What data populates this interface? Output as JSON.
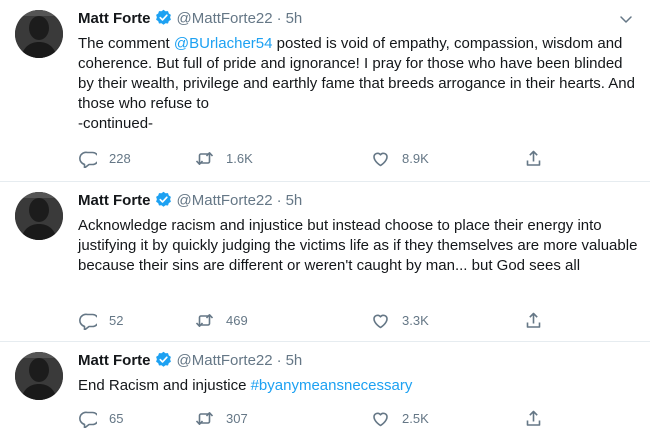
{
  "tweets": [
    {
      "name": "Matt Forte",
      "handle": "@MattForte22",
      "dot": "·",
      "time": "5h",
      "text_pre": "The comment ",
      "mention": "@BUrlacher54",
      "text_post": " posted is void of empathy, compassion, wisdom and coherence. But full of pride and ignorance! I pray for those who have been blinded by their wealth, privilege and earthly fame that breeds arrogance in their hearts. And those who refuse to",
      "text_line2": "-continued-",
      "replies": "228",
      "retweets": "1.6K",
      "likes": "8.9K"
    },
    {
      "name": "Matt Forte",
      "handle": "@MattForte22",
      "dot": "·",
      "time": "5h",
      "text": "Acknowledge racism and injustice but instead choose to place their energy into justifying it by quickly judging the victims life as if they themselves are more valuable because their sins are different or weren't caught by man... but God sees all",
      "replies": "52",
      "retweets": "469",
      "likes": "3.3K"
    },
    {
      "name": "Matt Forte",
      "handle": "@MattForte22",
      "dot": "·",
      "time": "5h",
      "text_pre": "End Racism and injustice ",
      "hashtag": "#byanymeansnecessary",
      "replies": "65",
      "retweets": "307",
      "likes": "2.5K"
    }
  ],
  "icons": {
    "verified": "verified-badge-icon",
    "caret": "chevron-down-icon",
    "reply": "reply-icon",
    "retweet": "retweet-icon",
    "like": "heart-icon",
    "share": "share-icon"
  },
  "colors": {
    "accent": "#1da1f2",
    "secondary_text": "#657786",
    "divider": "#e6ecf0"
  }
}
